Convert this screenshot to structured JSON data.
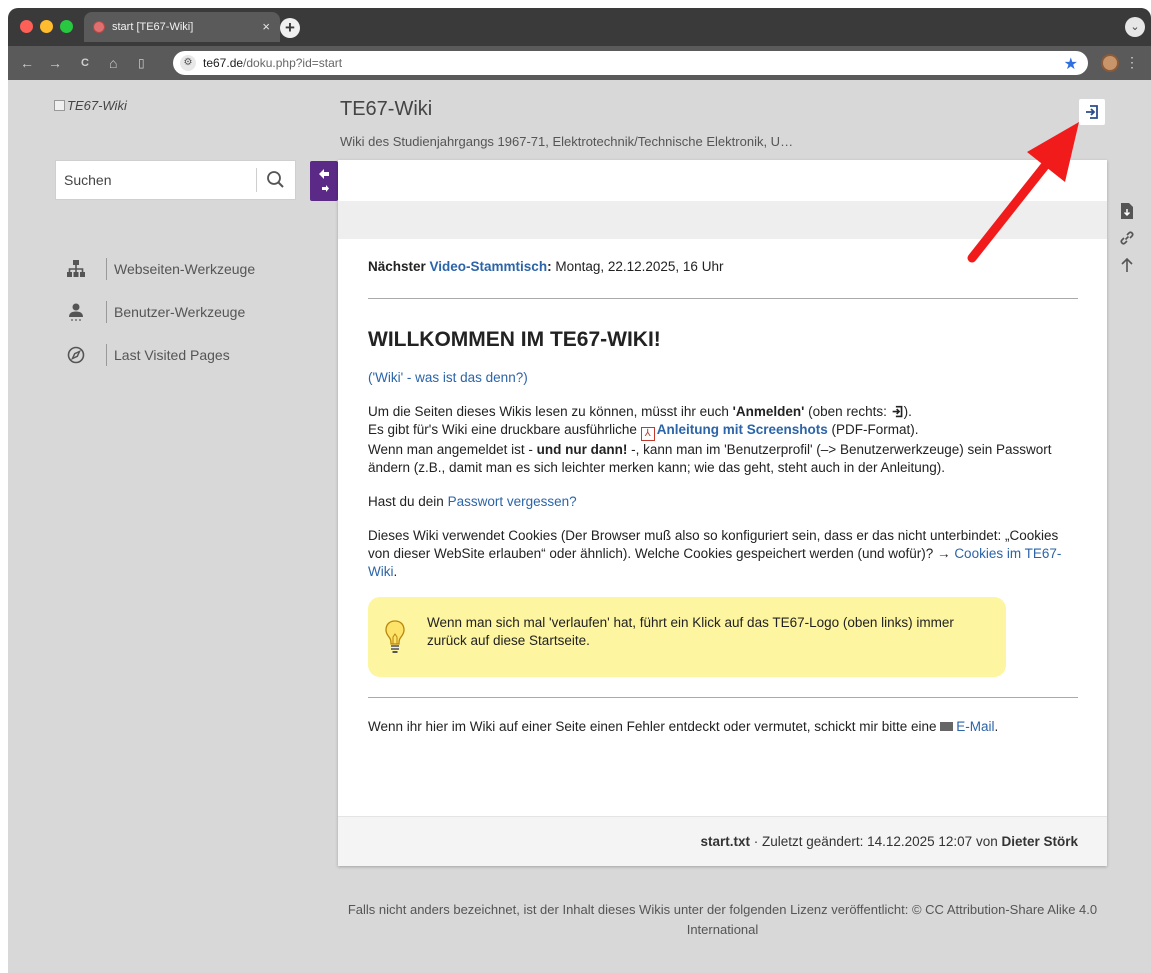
{
  "browser": {
    "tab_title": "start [TE67-Wiki]",
    "tab_close": "×",
    "new_tab": "+",
    "tab_menu": "⌄",
    "url_host": "te67.de",
    "url_path": "/doku.php?id=start",
    "star": "★",
    "menu": "⋮",
    "back": "←",
    "forward": "→",
    "reload": "C",
    "home": "⌂",
    "sidebar": "▯"
  },
  "header": {
    "logo_alt": "TE67-Wiki",
    "title": "TE67-Wiki",
    "tagline": "Wiki des Studienjahrgangs 1967-71, Elektrotechnik/Technische Elektronik, U…"
  },
  "search": {
    "placeholder": "Suchen"
  },
  "sidebar": {
    "items": [
      {
        "label": "Webseiten-Werkzeuge",
        "icon": "sitemap-icon"
      },
      {
        "label": "Benutzer-Werkzeuge",
        "icon": "user-icon"
      },
      {
        "label": "Last Visited Pages",
        "icon": "compass-icon"
      }
    ]
  },
  "content": {
    "stammtisch_prefix": "Nächster ",
    "stammtisch_link": "Video-Stammtisch",
    "stammtisch_colon": ":",
    "stammtisch_date": " Montag, 22.12.2025, 16 Uhr",
    "heading": "WILLKOMMEN IM TE67-WIKI!",
    "wiki_link": "('Wiki' - was ist das denn?)",
    "p1_a": "Um die Seiten dieses Wikis lesen zu können, müsst ihr euch ",
    "p1_b": "'Anmelden'",
    "p1_c": " (oben rechts: ",
    "p1_d": ").",
    "p1_e": "Es gibt für's Wiki eine druckbare ausführliche ",
    "p1_link": "Anleitung mit Screenshots",
    "p1_f": " (PDF-Format).",
    "p1_g": "Wenn man angemeldet ist - ",
    "p1_h": "und nur dann!",
    "p1_i": " -, kann man im 'Benutzerprofil' (–> Benutzerwerkzeuge) sein Passwort ändern (z.B., damit man es sich leichter merken kann; wie das geht, steht auch in der Anleitung).",
    "p2_a": "Hast du dein ",
    "p2_link": "Passwort vergessen?",
    "p3_a": "Dieses Wiki verwendet Cookies (Der Browser muß also so konfiguriert sein, dass er das nicht unterbindet: „Cookies von dieser WebSite erlauben“ oder ähnlich). Welche Cookies gespeichert werden (und wofür)? → ",
    "p3_link": "Cookies im TE67-Wiki",
    "p3_b": ".",
    "tip": "Wenn man sich mal 'verlaufen' hat, führt ein Klick auf das TE67-Logo (oben links) immer zurück auf diese Startseite.",
    "bottom_a": "Wenn ihr hier im Wiki auf einer Seite einen Fehler entdeckt oder vermutet, schickt mir bitte eine ",
    "bottom_link": "E-Mail",
    "bottom_b": "."
  },
  "footer": {
    "file": "start.txt",
    "changed": " · Zuletzt geändert: 14.12.2025 12:07 von ",
    "author": "Dieter Störk",
    "license": "Falls nicht anders bezeichnet, ist der Inhalt dieses Wikis unter der folgenden Lizenz veröffentlicht: © CC Attribution-Share Alike 4.0 International"
  },
  "colors": {
    "accent_purple": "#5b2a86",
    "link_blue": "#2b64a8",
    "tip_yellow": "#fdf5a0",
    "annotation_arrow": "#f21b1b"
  }
}
